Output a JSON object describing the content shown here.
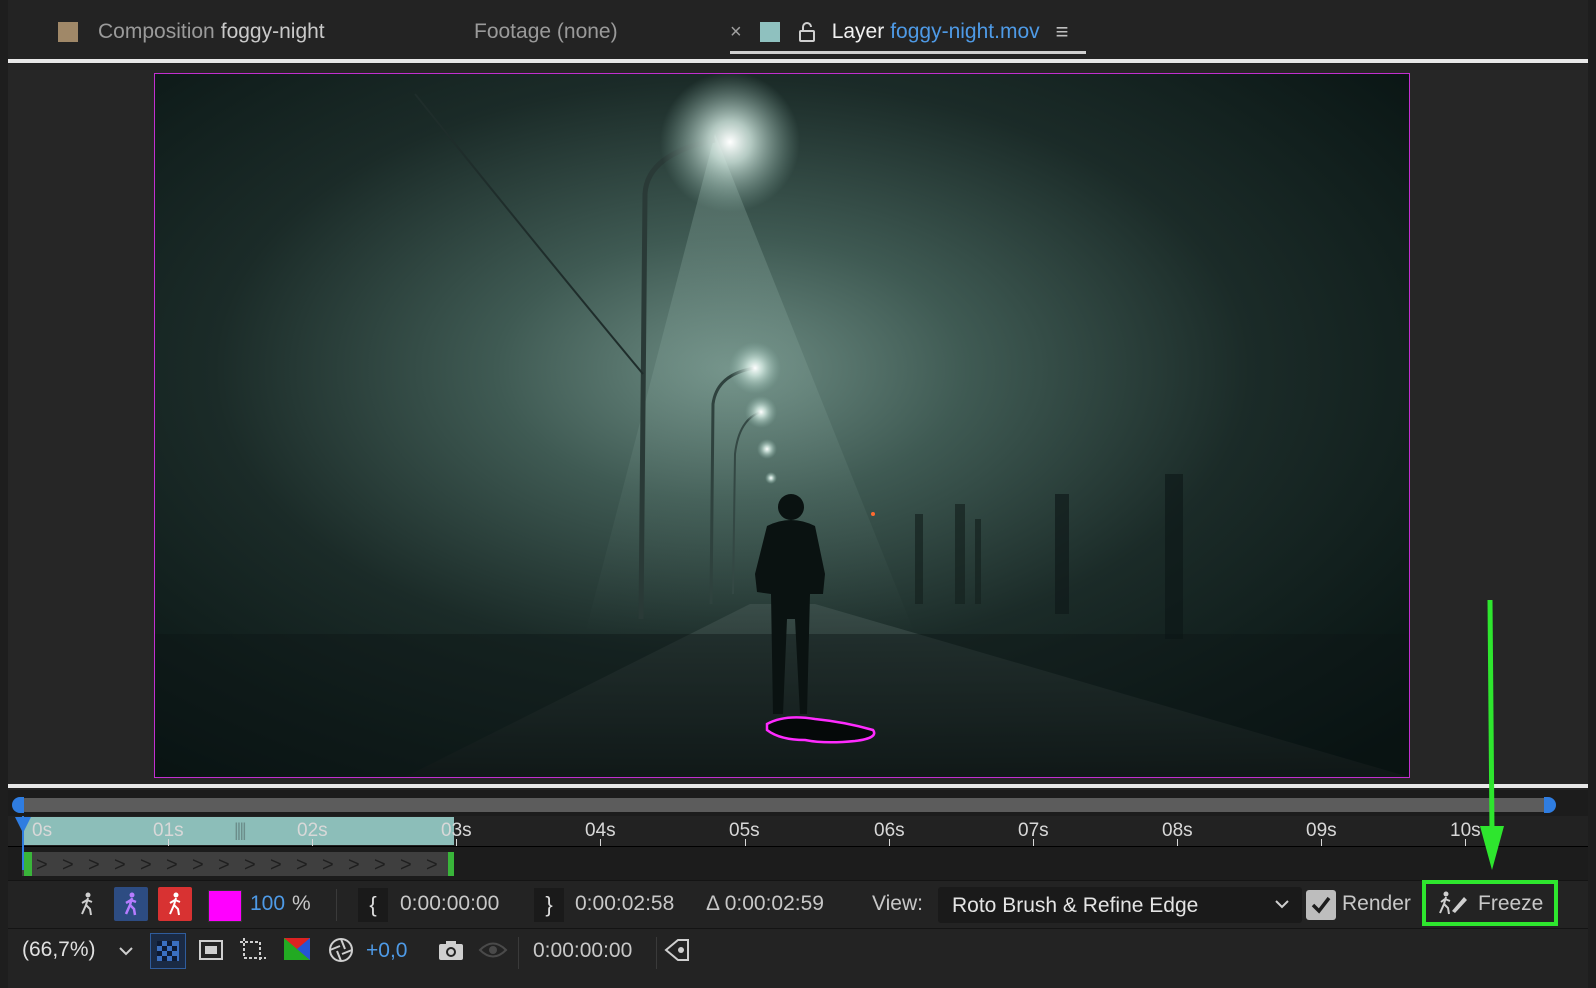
{
  "tabs": {
    "composition": {
      "label": "Composition",
      "name": "foggy-night"
    },
    "footage": {
      "label": "Footage (none)"
    },
    "layer": {
      "label": "Layer",
      "name": "foggy-night.mov",
      "close": "×",
      "menu": "≡"
    }
  },
  "timeline": {
    "ticks": [
      "0s",
      "01s",
      "02s",
      "03s",
      "04s",
      "05s",
      "06s",
      "07s",
      "08s",
      "09s",
      "10s"
    ],
    "cache_marks": "||||"
  },
  "controls": {
    "color_label": "100",
    "percent": "%",
    "in_time": "0:00:00:00",
    "out_time": "0:00:02:58",
    "duration": "Δ 0:00:02:59",
    "view_label": "View:",
    "view_value": "Roto Brush & Refine Edge",
    "render_label": "Render",
    "freeze_label": "Freeze",
    "swatch_color": "#ff00ff"
  },
  "footer": {
    "zoom": "(66,7%)",
    "exposure": "+0,0",
    "timecode": "0:00:00:00"
  },
  "colors": {
    "accent_blue": "#4e9ae6",
    "highlight_green": "#2ee62e",
    "mask_magenta": "#c22fd0"
  }
}
